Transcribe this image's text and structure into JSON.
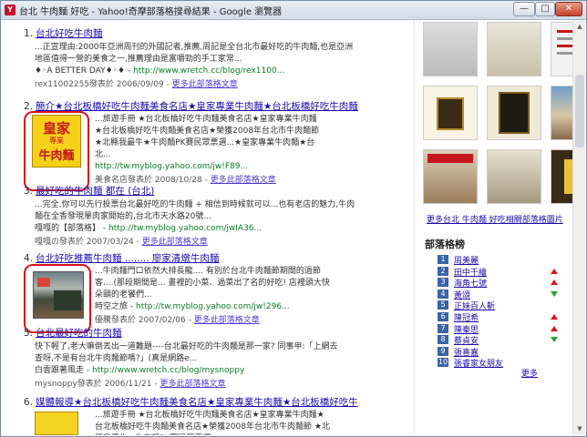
{
  "window": {
    "title": "台北 牛肉麵 好吃 - Yahoo!奇摩部落格搜尋結果 - Google 瀏覽器",
    "icon": "Y",
    "minimize": "—",
    "maximize": "□",
    "close": "✕"
  },
  "results": [
    {
      "num": "1.",
      "title": "台北好吃牛肉麵",
      "snippet": "...正宣理由:2000年亞洲周刊的外國記者,推薦,周記是全台北市最好吃的牛肉麵,也是亞洲地區值得一營的美食之一,推薦理由是富嚼勁的手工家常...",
      "source_line": "♦◦A BETTER DAY♦◦♦",
      "url": "http://www.wretch.cc/blog/rex1100...",
      "meta": "rex11002255發表於 2006/09/09",
      "more": "更多此部落格文章"
    },
    {
      "num": "2.",
      "title": "簡介★台北板橋好吃牛肉麵美食名店★皇家專業牛肉麵★台北板橋好吃牛肉麵",
      "snippet": "...旅遊手冊 ★台北板橋好吃牛肉麵美食名店★皇家專業牛肉麵★台北板橋好吃牛肉麵美食名店★榮獲2008年台北市牛肉麵節 ★北縣我最牛★牛肉麵PK賽民眾票選...★皇家專業牛肉麵★台北...",
      "url": "http://tw.myblog.yahoo.com/jw!F89...",
      "meta": "美食名店發表於 2008/10/28",
      "more": "更多此部落格文章",
      "thumb_text": [
        "皇家",
        "專業",
        "牛肉麵"
      ]
    },
    {
      "num": "3.",
      "title": "最好吃的牛肉麵 都在 (台北)",
      "snippet": "...完全,你可以先行投票台北最好吃的牛肉麵 + 相信到時候就可以...也有老店的魅力,牛肉麵在全香發現單肉家開始的,台北市天水路20號...",
      "source_line": "嘎嘎的【部落格】",
      "url": "http://tw.myblog.yahoo.com/jwIA36...",
      "meta": "嘎嘎の發表於 2007/03/24",
      "more": "更多此部落格文章"
    },
    {
      "num": "4.",
      "title": "台北好吃推薦牛肉麵 ........ 廖家清燉牛肉麵",
      "snippet": "...牛肉麵門口依然大排長龍.... 有別於台北牛肉麵節期間的過節客....(那段期間是... 畫裡的小菜、過菜出了名的好吃! 店裡頭大快朵頤的老饕們...",
      "source_line": "時空之旅",
      "url": "http://tw.myblog.yahoo.com/jw!296...",
      "meta": "優騰發表於 2007/02/06",
      "more": "更多此部落格文章"
    },
    {
      "num": "5.",
      "title": "台北最好吃的牛肉麵",
      "snippet": "快下輕了,老大嘛倒丟出一道難題----台北最好吃的牛肉麵是那一家? 同事甲:「上網去查呀,不是有台北牛肉麵節嗎?」(真是網路e...",
      "source_line": "白雲跟著風走",
      "url": "http://www.wretch.cc/blog/mysnoppy",
      "meta": "mysnoppy發表於 2006/11/21",
      "more": "更多此部落格文章"
    },
    {
      "num": "6.",
      "title": "媒體報導★台北板橋好吃牛肉麵美食名店★皇家專業牛肉麵★台北板橋好吃牛",
      "snippet": "...旅遊手冊 ★台北板橋好吃牛肉麵美食名店★皇家專業牛肉麵★台北板橋好吃牛肉麵美食名店★榮獲2008年台北市牛肉麵節 ★北縣我最牛★牛肉麵PK賽民眾票選..."
    }
  ],
  "sidebar": {
    "more_images": "更多台北 牛肉麵 好吃相關部落格圖片",
    "rank_title": "部落格榜",
    "rank_more": "更多",
    "rank": [
      {
        "no": "1",
        "name": "周美麗",
        "trend": "none"
      },
      {
        "no": "2",
        "name": "田中千繪",
        "trend": "up"
      },
      {
        "no": "3",
        "name": "海角七號",
        "trend": "up"
      },
      {
        "no": "4",
        "name": "黃頌",
        "trend": "down"
      },
      {
        "no": "5",
        "name": "正妹百人斬",
        "trend": "none"
      },
      {
        "no": "6",
        "name": "陳冠希",
        "trend": "up"
      },
      {
        "no": "7",
        "name": "陳秦思",
        "trend": "up"
      },
      {
        "no": "8",
        "name": "蔡貞安",
        "trend": "down"
      },
      {
        "no": "9",
        "name": "張喜嘉",
        "trend": "none"
      },
      {
        "no": "10",
        "name": "張睿家女朋友",
        "trend": "none"
      }
    ]
  },
  "colors": {
    "link": "#1a0dab",
    "highlight": "#c4161c",
    "url": "#0a7d28",
    "annotation": "#d8141d"
  }
}
